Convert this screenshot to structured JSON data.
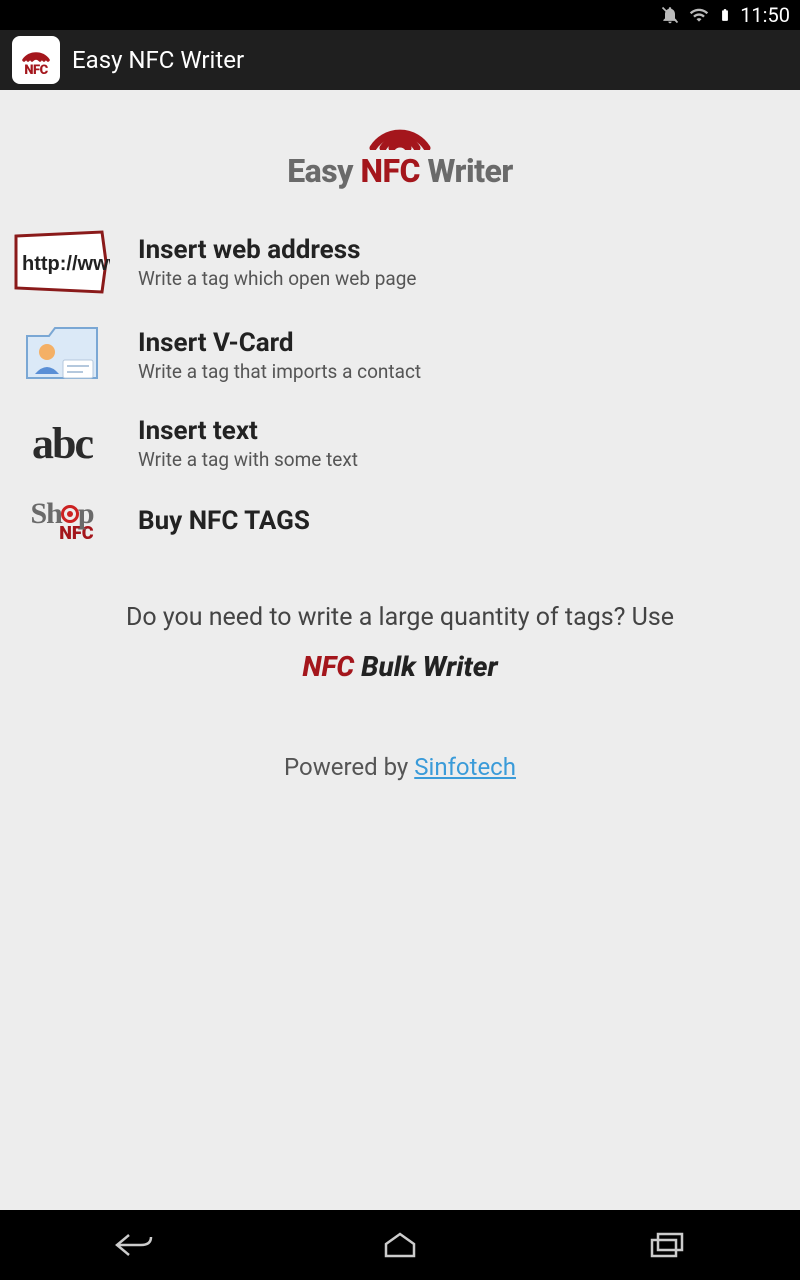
{
  "status": {
    "time": "11:50"
  },
  "header": {
    "title": "Easy NFC Writer"
  },
  "brand": {
    "easy": "Easy",
    "nfc": "NFC",
    "writer": "Writer"
  },
  "menu": [
    {
      "title": "Insert web address",
      "subtitle": "Write a tag which open web page"
    },
    {
      "title": "Insert V-Card",
      "subtitle": "Write a tag that imports a contact"
    },
    {
      "title": "Insert text",
      "subtitle": "Write a tag with some text"
    },
    {
      "title": "Buy NFC TAGS",
      "subtitle": ""
    }
  ],
  "promo": {
    "question": "Do you need to write a large quantity of tags? Use",
    "bulk_nfc": "NFC",
    "bulk_rest": "Bulk Writer"
  },
  "footer": {
    "powered": "Powered by ",
    "link": "Sinfotech"
  },
  "icons": {
    "abc": "abc",
    "shop": "Sh",
    "shop2": "p",
    "shop_nfc": "NFC",
    "http": "http://www"
  }
}
